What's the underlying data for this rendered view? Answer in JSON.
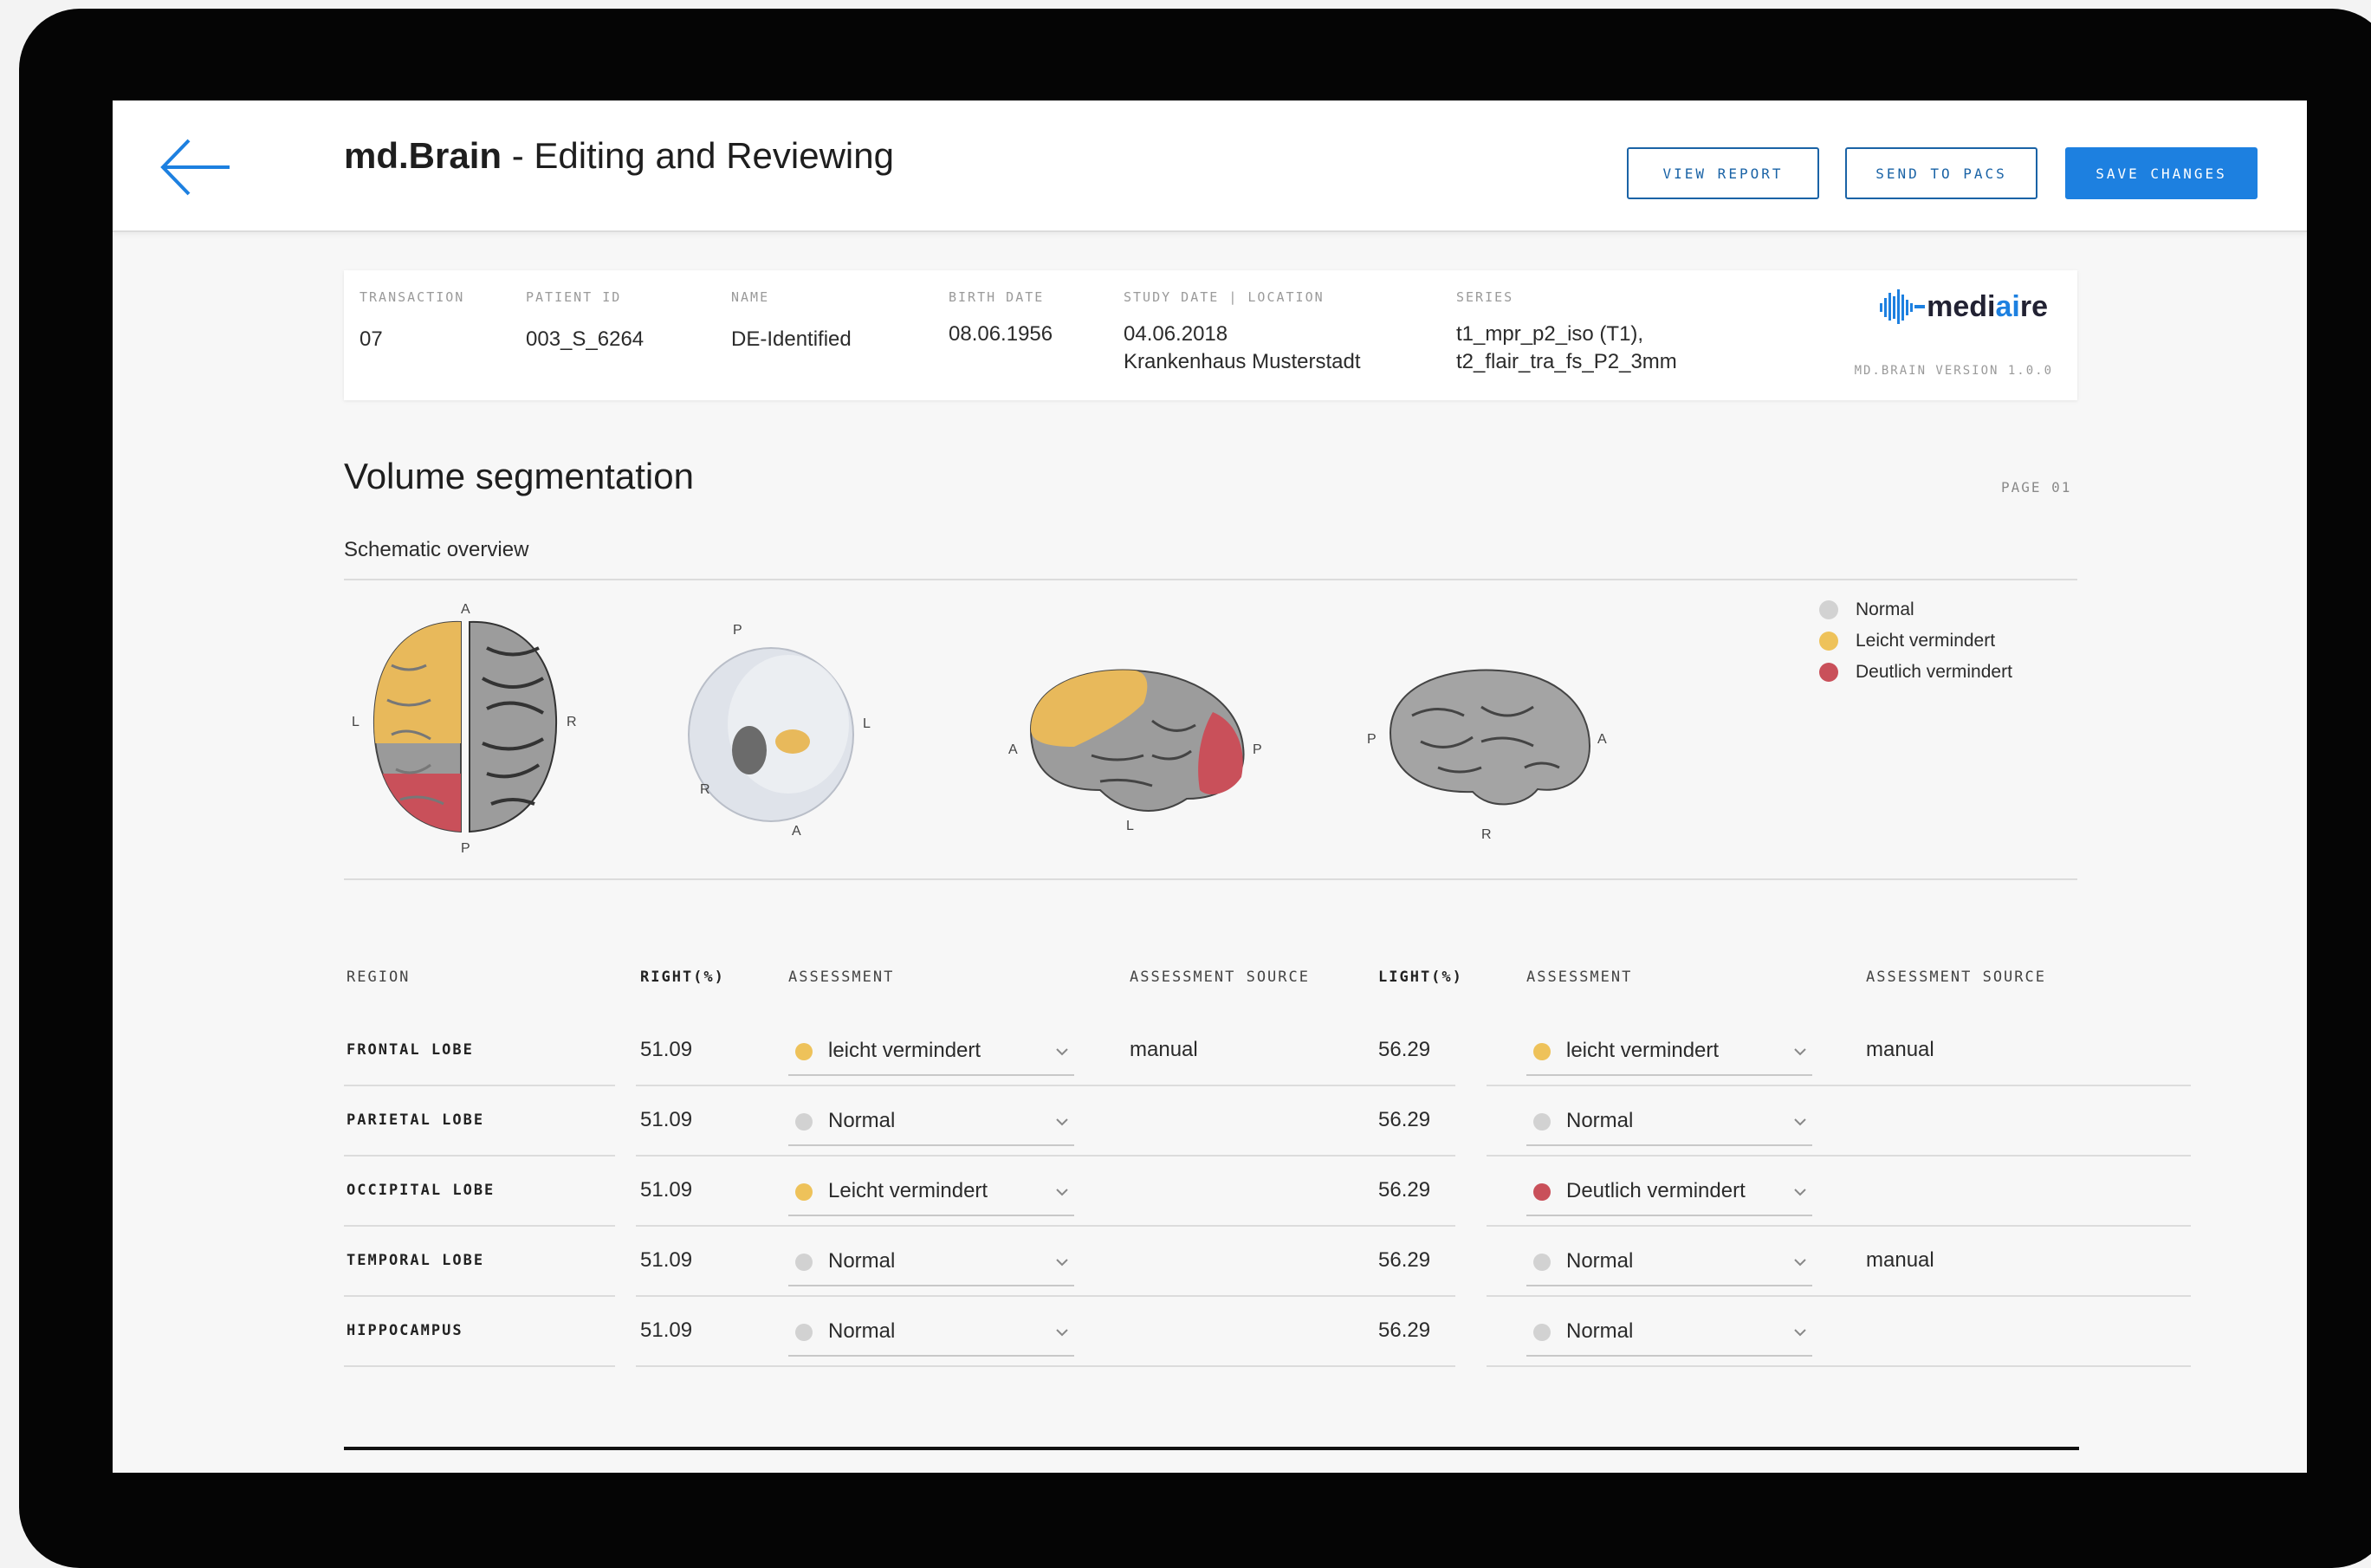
{
  "app": {
    "title_strong": "md.Brain",
    "title_rest": " - Editing and Reviewing",
    "buttons": {
      "view_report": "VIEW REPORT",
      "send_to_pacs": "SEND TO PACS",
      "save_changes": "SAVE CHANGES"
    }
  },
  "meta": {
    "transaction": {
      "label": "TRANSACTION",
      "value": "07"
    },
    "patient_id": {
      "label": "PATIENT ID",
      "value": "003_S_6264"
    },
    "name": {
      "label": "NAME",
      "value": "DE-Identified"
    },
    "birth_date": {
      "label": "BIRTH DATE",
      "value": "08.06.1956"
    },
    "study": {
      "label": "STUDY DATE | LOCATION",
      "date": "04.06.2018",
      "location": "Krankenhaus Musterstadt"
    },
    "series": {
      "label": "SERIES",
      "line1": "t1_mpr_p2_iso (T1),",
      "line2": "t2_flair_tra_fs_P2_3mm"
    },
    "logo_pre": "medi",
    "logo_accent": "ai",
    "logo_post": "re",
    "version": "MD.BRAIN VERSION 1.0.0"
  },
  "section": {
    "title": "Volume segmentation",
    "page": "PAGE 01",
    "subtitle": "Schematic overview"
  },
  "colors": {
    "normal": "#d2d2d2",
    "leicht": "#eec25a",
    "deutlich": "#c9505a",
    "accent": "#1d80e0"
  },
  "legend": [
    {
      "label": "Normal",
      "color": "#d2d2d2"
    },
    {
      "label": "Leicht vermindert",
      "color": "#eec25a"
    },
    {
      "label": "Deutlich vermindert",
      "color": "#c9505a"
    }
  ],
  "views": {
    "top": {
      "a": "A",
      "p": "P",
      "l": "L",
      "r": "R"
    },
    "hippo": {
      "p": "P",
      "l": "L",
      "r": "R",
      "a": "A"
    },
    "left": {
      "a": "A",
      "p": "P",
      "l": "L"
    },
    "right": {
      "p": "P",
      "a": "A",
      "r": "R"
    }
  },
  "table": {
    "headers": {
      "region": "REGION",
      "right": "RIGHT(%)",
      "assessment": "ASSESSMENT",
      "assessment_source": "ASSESSMENT SOURCE",
      "left": "LIGHT(%)",
      "assessment2": "ASSESSMENT",
      "assessment_source2": "ASSESSMENT SOURCE"
    },
    "rows": [
      {
        "region": "FRONTAL LOBE",
        "right": "51.09",
        "right_assess": "leicht vermindert",
        "right_color": "#eec25a",
        "right_src": "manual",
        "left": "56.29",
        "left_assess": "leicht vermindert",
        "left_color": "#eec25a",
        "left_src": "manual"
      },
      {
        "region": "PARIETAL LOBE",
        "right": "51.09",
        "right_assess": "Normal",
        "right_color": "#d2d2d2",
        "right_src": "",
        "left": "56.29",
        "left_assess": "Normal",
        "left_color": "#d2d2d2",
        "left_src": ""
      },
      {
        "region": "OCCIPITAL LOBE",
        "right": "51.09",
        "right_assess": "Leicht vermindert",
        "right_color": "#eec25a",
        "right_src": "",
        "left": "56.29",
        "left_assess": "Deutlich vermindert",
        "left_color": "#c9505a",
        "left_src": ""
      },
      {
        "region": "TEMPORAL LOBE",
        "right": "51.09",
        "right_assess": "Normal",
        "right_color": "#d2d2d2",
        "right_src": "",
        "left": "56.29",
        "left_assess": "Normal",
        "left_color": "#d2d2d2",
        "left_src": "manual"
      },
      {
        "region": "HIPPOCAMPUS",
        "right": "51.09",
        "right_assess": "Normal",
        "right_color": "#d2d2d2",
        "right_src": "",
        "left": "56.29",
        "left_assess": "Normal",
        "left_color": "#d2d2d2",
        "left_src": ""
      }
    ]
  }
}
